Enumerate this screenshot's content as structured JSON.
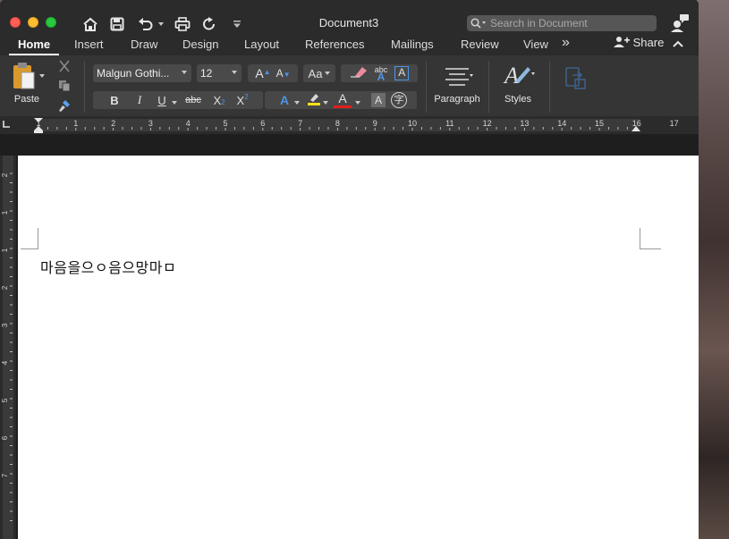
{
  "window": {
    "title": "Document3"
  },
  "search": {
    "placeholder": "Search in Document"
  },
  "tabs": [
    "Home",
    "Insert",
    "Draw",
    "Design",
    "Layout",
    "References",
    "Mailings",
    "Review",
    "View"
  ],
  "tabs_overflow_label": "»",
  "share": {
    "label": "Share"
  },
  "ribbon": {
    "paste_label": "Paste",
    "font_name": "Malgun Gothi...",
    "font_size": "12",
    "grow_font": "A",
    "shrink_font": "A",
    "change_case": "Aa",
    "bold": "B",
    "italic": "I",
    "underline": "U",
    "strikethrough": "abc",
    "subscript": "X",
    "superscript": "X",
    "text_effects": "A",
    "font_color": "A",
    "char_shading": "A",
    "enclose_char": "字",
    "clear_format_text": "abc",
    "clear_format_letter": "A",
    "text_box_letter": "A",
    "paragraph_label": "Paragraph",
    "styles_label": "Styles"
  },
  "colors": {
    "highlight": "#f7e01a",
    "font_color": "#e0201b",
    "accent_blue": "#4f94e6"
  },
  "ruler": {
    "horizontal": [
      "1",
      "1",
      "2",
      "3",
      "4",
      "5",
      "6",
      "7",
      "8",
      "9",
      "10",
      "11",
      "12",
      "13",
      "14",
      "15",
      "16",
      "17"
    ],
    "vertical": [
      "2",
      "1",
      "1",
      "2",
      "3",
      "4",
      "5",
      "6",
      "7"
    ]
  },
  "document": {
    "text": "마음을으ㅇ음으망마ㅁ"
  }
}
